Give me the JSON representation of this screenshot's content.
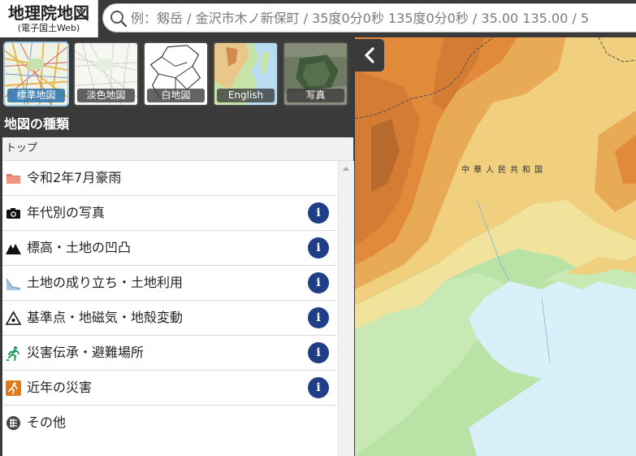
{
  "header": {
    "logo_title": "地理院地図",
    "logo_subtitle": "(電子国土Web)",
    "search_placeholder": "例：剱岳 / 金沢市木ノ新保町 / 35度0分0秒 135度0分0秒 / 35.00 135.00 / 5"
  },
  "panel": {
    "map_types": [
      {
        "label": "標準地図",
        "selected": true
      },
      {
        "label": "淡色地図",
        "selected": false
      },
      {
        "label": "白地図",
        "selected": false
      },
      {
        "label": "English",
        "selected": false
      },
      {
        "label": "写真",
        "selected": false
      }
    ],
    "section_title": "地図の種類",
    "breadcrumb": "トップ",
    "items": [
      {
        "label": "令和2年7月豪雨",
        "icon": "folder-icon",
        "info": false
      },
      {
        "label": "年代別の写真",
        "icon": "camera-icon",
        "info": true
      },
      {
        "label": "標高・土地の凹凸",
        "icon": "mountain-icon",
        "info": true
      },
      {
        "label": "土地の成り立ち・土地利用",
        "icon": "landform-icon",
        "info": true
      },
      {
        "label": "基準点・地磁気・地殻変動",
        "icon": "triangulation-point-icon",
        "info": true
      },
      {
        "label": "災害伝承・避難場所",
        "icon": "evacuation-icon",
        "info": true
      },
      {
        "label": "近年の災害",
        "icon": "disaster-icon",
        "info": true
      },
      {
        "label": "その他",
        "icon": "other-icon",
        "info": false
      }
    ],
    "info_label": "i"
  },
  "map": {
    "country_label": "中華人民共和国",
    "colors": {
      "sea": "#d9f0f9",
      "lowland": "#b9e3a6",
      "hill": "#f0d48a",
      "mountain": "#e08a3a",
      "peak": "#b86a2c"
    }
  }
}
